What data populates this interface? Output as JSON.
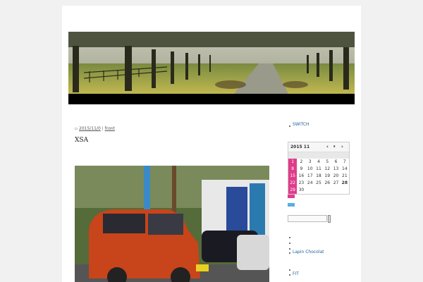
{
  "post": {
    "date": "2015/11/0",
    "category": "front",
    "title": "XSA"
  },
  "sidebar": {
    "switch_label": "SWITCH",
    "lapin_label": "Lapin Chocolat",
    "fit_label": "FIT"
  },
  "calendar": {
    "title": "2015 11",
    "prev_icon": "‹",
    "pause_icon": "⏸",
    "next_icon": "›",
    "rows": [
      [
        "1",
        "2",
        "3",
        "4",
        "5",
        "6",
        "7"
      ],
      [
        "8",
        "9",
        "10",
        "11",
        "12",
        "13",
        "14"
      ],
      [
        "15",
        "16",
        "17",
        "18",
        "19",
        "20",
        "21"
      ],
      [
        "22",
        "23",
        "24",
        "25",
        "26",
        "27",
        "28"
      ],
      [
        "29",
        "30",
        "",
        "",
        "",
        "",
        ""
      ]
    ]
  },
  "colors": {
    "accent_pink": "#e03c8a",
    "accent_blue": "#5aaee0",
    "link_blue": "#1a5f9a"
  }
}
